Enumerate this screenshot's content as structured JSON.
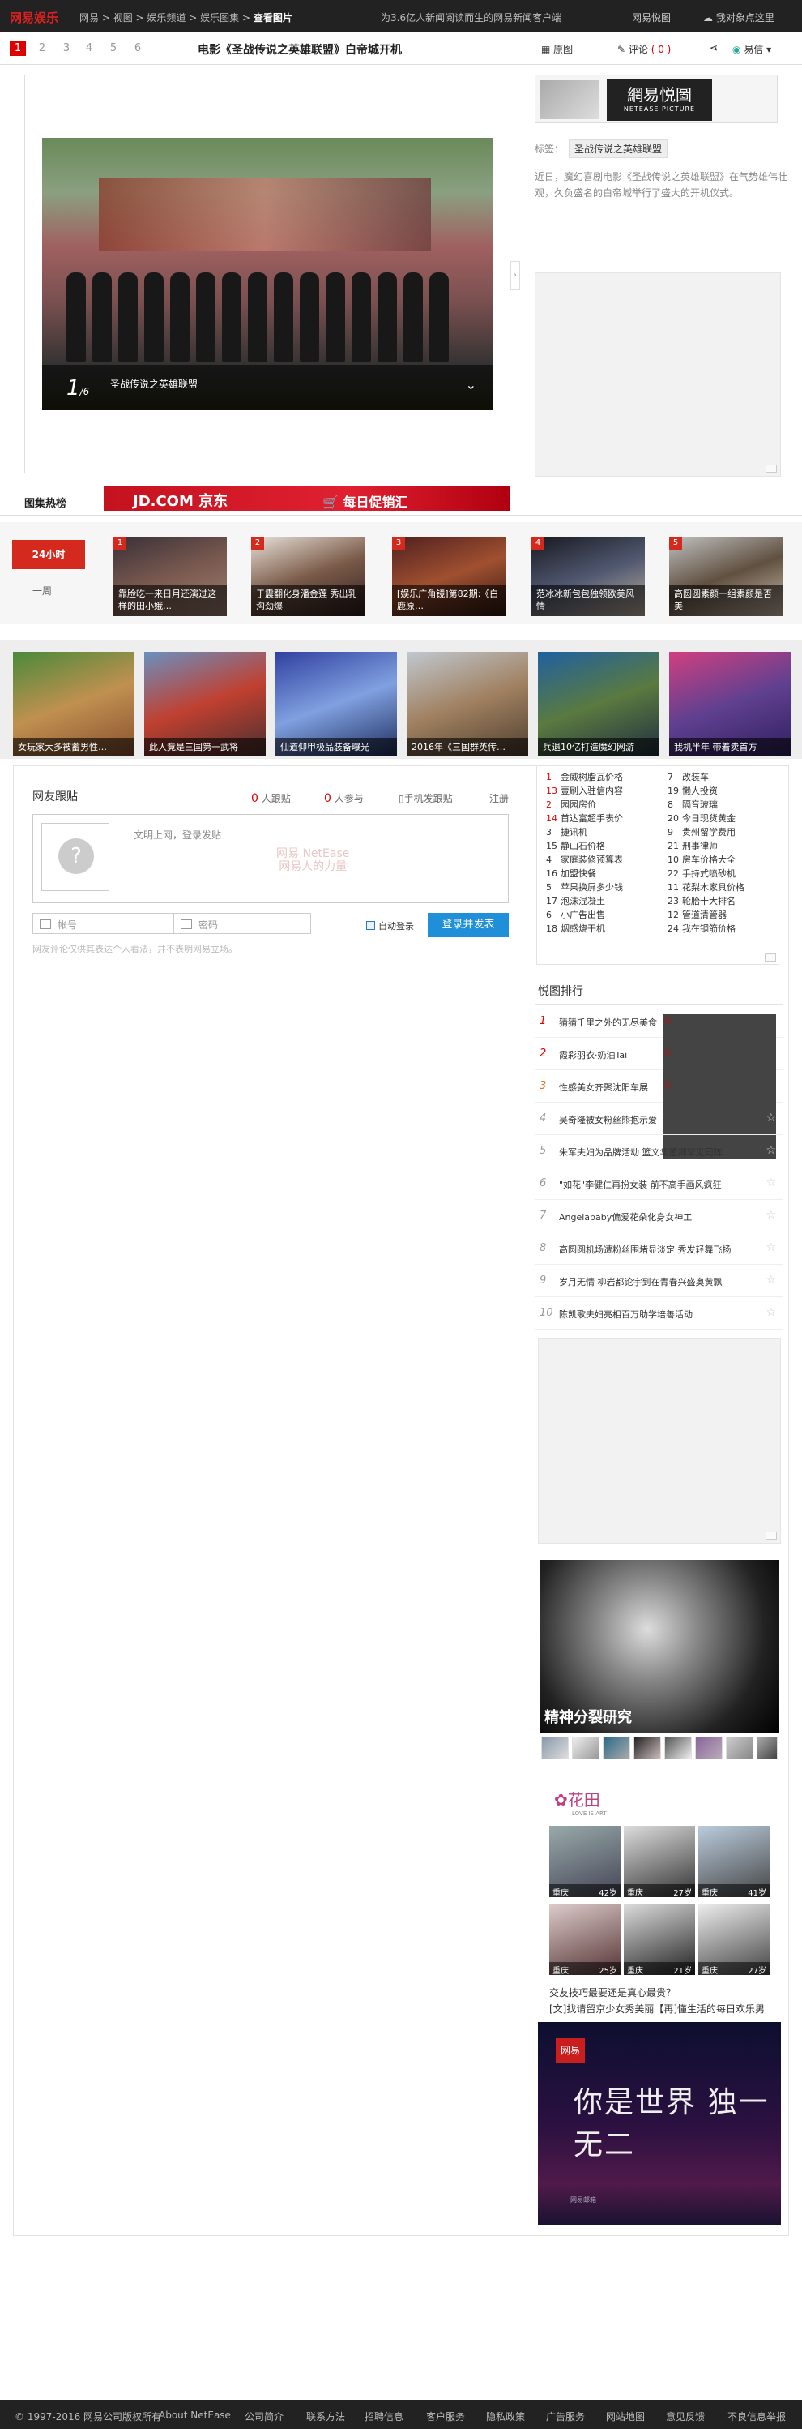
{
  "topbar": {
    "logo": "网易娱乐",
    "breadcrumbs": [
      "网易",
      "视图",
      "娱乐频道",
      "娱乐图集"
    ],
    "current": "查看图片",
    "headline": "为3.6亿人新闻阅读而生的网易新闻客户端",
    "right_link1": "网易悦图",
    "right_link2": "我对象点这里"
  },
  "viewbar": {
    "pages": [
      "1",
      "2",
      "3",
      "4",
      "5",
      "6"
    ],
    "title": "电影《圣战传说之英雄联盟》白帝城开机",
    "tool_thumbs": "原图",
    "tool_comment": "评论",
    "comment_count": "( 0 )",
    "tool_share": "易信"
  },
  "photo": {
    "index": "1",
    "total": "6",
    "caption": "圣战传说之英雄联盟"
  },
  "side": {
    "brand_logo": "網易悦圖",
    "brand_sub": "NETEASE PICTURE",
    "tags_label": "标签：",
    "tag": "圣战传说之英雄联盟",
    "description": "近日，魔幻喜剧电影《圣战传说之英雄联盟》在气势雄伟壮观，久负盛名的白帝城举行了盛大的开机仪式。"
  },
  "hotlist": {
    "tab_label": "图集热榜",
    "jd_text": "JD.COM 京东",
    "jd_slogan": "每日促销汇",
    "tab_24h": "24小时",
    "tab_week": "一周",
    "items": [
      {
        "rank": "1",
        "caption": "靠脸吃一来日月还演过这样的田小娥…"
      },
      {
        "rank": "2",
        "caption": "于震翻化身潘金莲 秀出乳沟劲爆"
      },
      {
        "rank": "3",
        "caption": "[娱乐广角镜]第82期:《白鹿原…"
      },
      {
        "rank": "4",
        "caption": "范冰冰新包包独领欧美风情"
      },
      {
        "rank": "5",
        "caption": "高圆圆素颜一组素颜是否美"
      }
    ]
  },
  "strip": [
    "女玩家大多被蓄男性…",
    "此人竟是三国第一武将",
    "仙道仰甲极品装备曝光",
    "2016年《三国群英传…",
    "兵退10亿打造魔幻网游",
    "我机半年 带着卖首方"
  ],
  "comments": {
    "title": "网友跟贴",
    "count1": "0",
    "label1": "人跟贴",
    "count2": "0",
    "label2": "人参与",
    "mobile": "手机发跟贴",
    "register": "注册",
    "placeholder": "文明上网，登录发贴",
    "watermark1": "网易",
    "watermark2": "NetEase",
    "watermark3": "网易人的力量",
    "account_placeholder": "帐号",
    "password_placeholder": "密码",
    "auto_login": "自动登录",
    "submit": "登录并发表",
    "disclaimer": "网友评论仅供其表达个人看法，并不表明网易立场。"
  },
  "rank_top": [
    [
      "1",
      "金威树脂瓦价格"
    ],
    [
      "13",
      "壹刷入驻信内容"
    ],
    [
      "2",
      "园园房价"
    ],
    [
      "14",
      "首达富超手表价"
    ],
    [
      "3",
      "捷讯机"
    ],
    [
      "15",
      "静山石价格"
    ],
    [
      "4",
      "家庭装修预算表"
    ],
    [
      "16",
      "加盟快餐"
    ],
    [
      "5",
      "苹果换屏多少钱"
    ],
    [
      "17",
      "泡沫混凝土"
    ],
    [
      "6",
      "小广告出售"
    ],
    [
      "18",
      "烟感烧干机"
    ],
    [
      "7",
      "改装车"
    ],
    [
      "19",
      "懒人投资"
    ],
    [
      "8",
      "隔音玻璃"
    ],
    [
      "20",
      "今日现货黄金"
    ],
    [
      "9",
      "贵州留学费用"
    ],
    [
      "21",
      "刑事律师"
    ],
    [
      "10",
      "房车价格大全"
    ],
    [
      "22",
      "手持式喷砂机"
    ],
    [
      "11",
      "花梨木家具价格"
    ],
    [
      "23",
      "轮胎十大排名"
    ],
    [
      "12",
      "管道清管器"
    ],
    [
      "24",
      "我在钢筋价格"
    ]
  ],
  "popular": {
    "title": "悦图排行",
    "items": [
      "猜猜千里之外的无尽美食",
      "霞彩羽衣·奶油Tai",
      "性感美女齐聚沈阳车展",
      "吴奇隆被女粉丝熊抱示爱",
      "朱军夫妇为品牌活动 篮文华董卿罕见同阵",
      "\"如花\"李健仁再扮女装 前不高手画风疯狂",
      "Angelababy偏爱花朵化身女神工",
      "高圆圆机场遭粉丝围堵显淡定 秀发轻舞飞扬",
      "岁月无情 柳岩都论宇到在青春兴盛奥黄飘",
      "陈凯歌夫妇亮相百万助学培善活动"
    ]
  },
  "psych": {
    "title": "精神分裂研究"
  },
  "huatian": {
    "logo": "花田",
    "sub": "LOVE IS ART",
    "profiles": [
      {
        "city": "重庆",
        "age": "42岁"
      },
      {
        "city": "重庆",
        "age": "27岁"
      },
      {
        "city": "重庆",
        "age": "41岁"
      },
      {
        "city": "重庆",
        "age": "25岁"
      },
      {
        "city": "重庆",
        "age": "21岁"
      },
      {
        "city": "重庆",
        "age": "27岁"
      }
    ],
    "q1": "交友技巧最要还是真心最贵？",
    "q2": "[文]找请留京少女秀美丽【再]懂生活的每日欢乐男"
  },
  "ad3": {
    "logo": "网易",
    "big": "你是世界 独一无二",
    "small": "网易邮箱"
  },
  "footer": [
    "© 1997-2016 网易公司版权所有",
    "About NetEase",
    "公司简介",
    "联系方法",
    "招聘信息",
    "客户服务",
    "隐私政策",
    "广告服务",
    "网站地图",
    "意见反馈",
    "不良信息举报"
  ],
  "colors": {
    "accent": "#d42a1e",
    "button": "#1e8fd8",
    "topbar": "#222222"
  }
}
